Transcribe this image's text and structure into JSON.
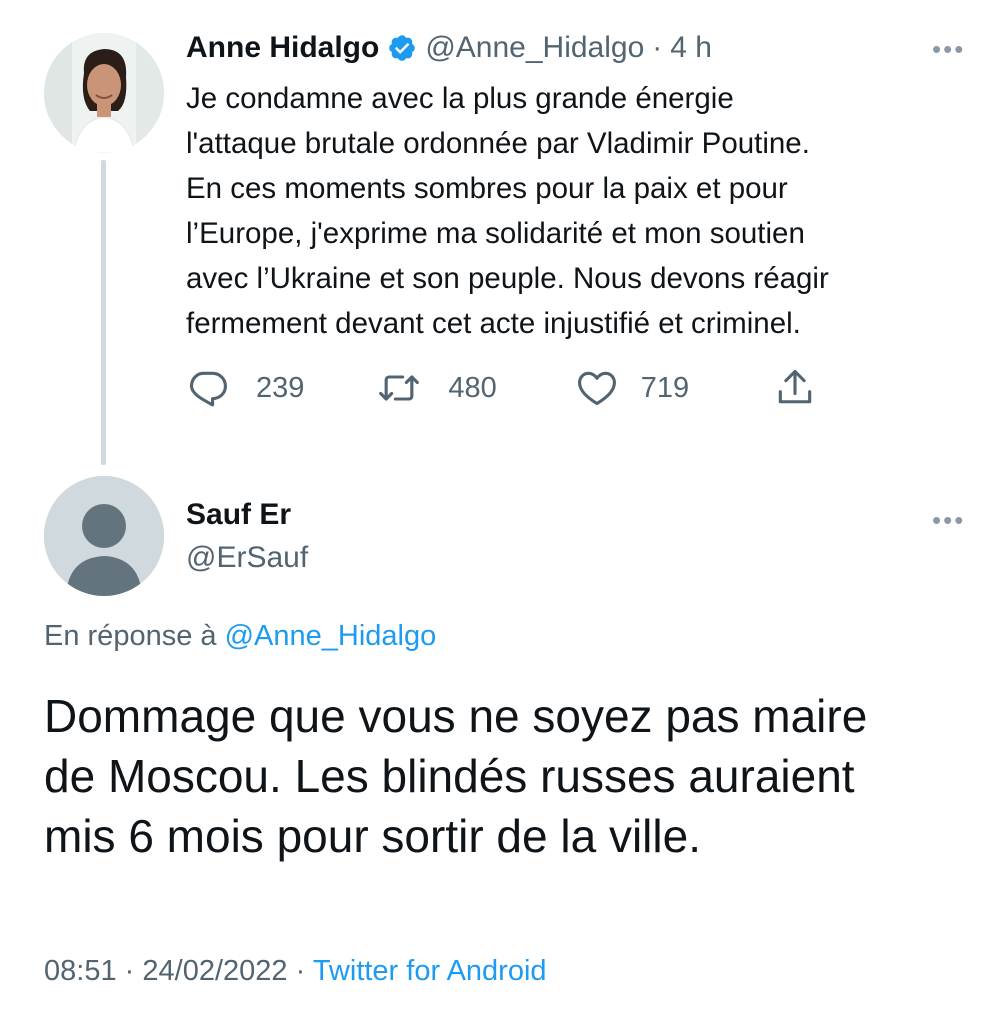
{
  "tweet": {
    "author_name": "Anne Hidalgo",
    "handle": "@Anne_Hidalgo",
    "separator": "·",
    "time": "4 h",
    "text_lines": [
      "Je condamne avec la plus grande énergie",
      "l'attaque brutale ordonnée par Vladimir Poutine.",
      "En ces moments sombres pour la paix et pour",
      "l’Europe, j'exprime ma solidarité et mon soutien",
      "avec l’Ukraine et son peuple. Nous devons réagir",
      "fermement devant cet acte injustifié et criminel."
    ],
    "replies": "239",
    "retweets": "480",
    "likes": "719",
    "more_icon": "more-dots-icon"
  },
  "reply": {
    "author_name": "Sauf Er",
    "handle": "@ErSauf",
    "reply_to_prefix": "En réponse à",
    "reply_to_handle": "@Anne_Hidalgo",
    "text_lines": [
      "Dommage que vous ne soyez pas maire",
      "de Moscou. Les blindés russes auraient",
      "mis 6 mois pour sortir de la ville."
    ],
    "time": "08:51",
    "separator": "·",
    "date": "24/02/2022",
    "source": "Twitter for Android"
  },
  "colors": {
    "text": "#0f1419",
    "secondary": "#536471",
    "accent": "#1d9bf0",
    "thread_line": "#cfd9de"
  }
}
